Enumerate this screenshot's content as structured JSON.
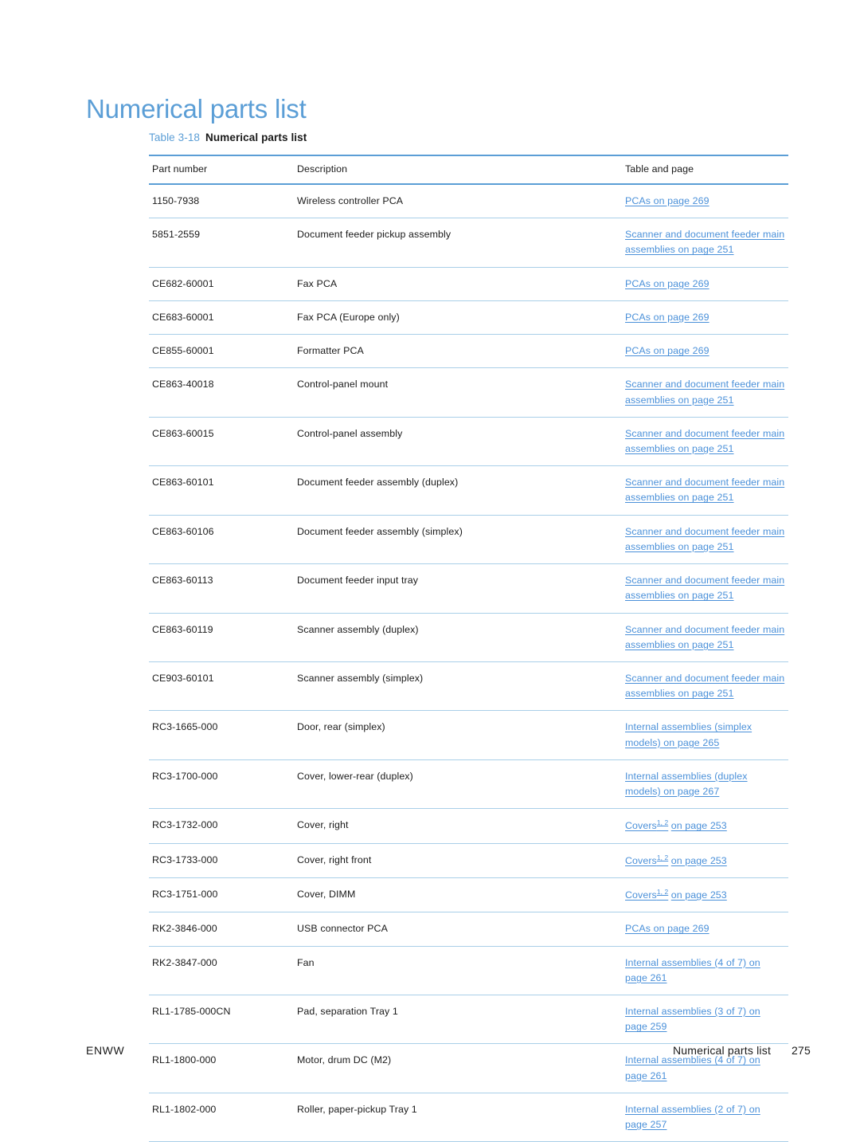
{
  "document": {
    "heading": "Numerical parts list",
    "caption_number": "Table 3-18",
    "caption_title": "Numerical parts list",
    "accent_color": "#5b9ed6",
    "link_color": "#4a90d9",
    "rule_color": "#a9cfe8"
  },
  "table": {
    "columns": [
      "Part number",
      "Description",
      "Table and page"
    ],
    "rows": [
      {
        "part": "1150-7938",
        "description": "Wireless controller PCA",
        "reference": "PCAs on page 269",
        "superscript": ""
      },
      {
        "part": "5851-2559",
        "description": "Document feeder pickup assembly",
        "reference": "Scanner and document feeder main assemblies on page 251",
        "superscript": ""
      },
      {
        "part": "CE682-60001",
        "description": "Fax PCA",
        "reference": "PCAs on page 269",
        "superscript": ""
      },
      {
        "part": "CE683-60001",
        "description": "Fax PCA (Europe only)",
        "reference": "PCAs on page 269",
        "superscript": ""
      },
      {
        "part": "CE855-60001",
        "description": "Formatter PCA",
        "reference": "PCAs on page 269",
        "superscript": ""
      },
      {
        "part": "CE863-40018",
        "description": "Control-panel mount",
        "reference": "Scanner and document feeder main assemblies on page 251",
        "superscript": ""
      },
      {
        "part": "CE863-60015",
        "description": "Control-panel assembly",
        "reference": "Scanner and document feeder main assemblies on page 251",
        "superscript": ""
      },
      {
        "part": "CE863-60101",
        "description": "Document feeder assembly (duplex)",
        "reference": "Scanner and document feeder main assemblies on page 251",
        "superscript": ""
      },
      {
        "part": "CE863-60106",
        "description": "Document feeder assembly (simplex)",
        "reference": "Scanner and document feeder main assemblies on page 251",
        "superscript": ""
      },
      {
        "part": "CE863-60113",
        "description": "Document feeder input tray",
        "reference": "Scanner and document feeder main assemblies on page 251",
        "superscript": ""
      },
      {
        "part": "CE863-60119",
        "description": "Scanner assembly (duplex)",
        "reference": "Scanner and document feeder main assemblies on page 251",
        "superscript": ""
      },
      {
        "part": "CE903-60101",
        "description": "Scanner assembly (simplex)",
        "reference": "Scanner and document feeder main assemblies on page 251",
        "superscript": ""
      },
      {
        "part": "RC3-1665-000",
        "description": "Door, rear (simplex)",
        "reference": "Internal assemblies (simplex models) on page 265",
        "superscript": ""
      },
      {
        "part": "RC3-1700-000",
        "description": "Cover, lower-rear (duplex)",
        "reference": "Internal assemblies (duplex models) on page 267",
        "superscript": ""
      },
      {
        "part": "RC3-1732-000",
        "description": "Cover, right",
        "reference": "Covers",
        "superscript": "1, 2",
        "reference_tail": "on page 253"
      },
      {
        "part": "RC3-1733-000",
        "description": "Cover, right front",
        "reference": "Covers",
        "superscript": "1, 2",
        "reference_tail": "on page 253"
      },
      {
        "part": "RC3-1751-000",
        "description": "Cover, DIMM",
        "reference": "Covers",
        "superscript": "1, 2",
        "reference_tail": "on page 253"
      },
      {
        "part": "RK2-3846-000",
        "description": "USB connector PCA",
        "reference": "PCAs on page 269",
        "superscript": ""
      },
      {
        "part": "RK2-3847-000",
        "description": "Fan",
        "reference": "Internal assemblies (4 of 7) on page 261",
        "superscript": ""
      },
      {
        "part": "RL1-1785-000CN",
        "description": "Pad, separation Tray 1",
        "reference": "Internal assemblies (3 of 7) on page 259",
        "superscript": ""
      },
      {
        "part": "RL1-1800-000",
        "description": "Motor, drum DC (M2)",
        "reference": "Internal assemblies (4 of 7) on page 261",
        "superscript": ""
      },
      {
        "part": "RL1-1802-000",
        "description": "Roller, paper-pickup Tray 1",
        "reference": "Internal assemblies (2 of 7) on page 257",
        "superscript": ""
      }
    ]
  },
  "footer": {
    "left": "ENWW",
    "title": "Numerical parts list",
    "page": "275"
  }
}
